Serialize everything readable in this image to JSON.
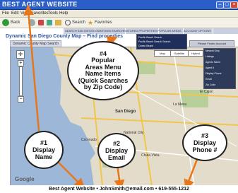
{
  "window": {
    "title": "BEST AGENT WEBSITE"
  },
  "menu": {
    "items": [
      "File",
      "Edit",
      "View",
      "Favorites",
      "Tools",
      "Help"
    ]
  },
  "toolbar": {
    "back": "Back",
    "search": "Search",
    "favorites": "Favorites"
  },
  "navbar": {
    "items": [
      "SEARCH SAN DIEGO",
      "DOWNTOWN SEARCH",
      "FEATURED PROPERTIES",
      "POPULAR AREAS",
      "ACCOUNT OPTIONS"
    ]
  },
  "page": {
    "title": "Dynamic San Diego County Map – Find properties"
  },
  "tabs": {
    "map_search": "Dynamic County Map Search"
  },
  "map": {
    "type_buttons": [
      "Map",
      "Satellite",
      "Hybrid"
    ],
    "finder_button": "Please Finder Account",
    "dropdown_items": [
      "Pacific Beach Search",
      "Pacific Beach Search Search",
      "Ocean Beach"
    ],
    "legend_items": [
      "Newest Only",
      "Listings",
      "Agents Name",
      "Agent #",
      "Display Phone",
      "Email",
      "Zip Code"
    ],
    "brand": "Google",
    "city_labels": [
      "San Diego",
      "La Mesa",
      "El Cajon",
      "Coronado",
      "National City",
      "Chula Vista"
    ]
  },
  "callouts": {
    "c4": [
      "#4",
      "Popular",
      "Areas Menu",
      "Name Items",
      "(Quick Searches",
      "by Zip Code)"
    ],
    "c1": [
      "#1",
      "Display",
      "Name"
    ],
    "c2": [
      "#2",
      "Display",
      "Email"
    ],
    "c3": [
      "#3",
      "Display",
      "Phone #"
    ]
  },
  "footer": {
    "text": "Best Agent Website • JohnSmith@email.com • 619-555-1212"
  },
  "colors": {
    "titlebar": "#2b5fc7",
    "callout_border": "#222222",
    "arrow": "#e8761a"
  }
}
